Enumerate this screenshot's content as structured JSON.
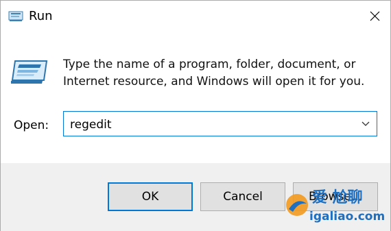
{
  "window": {
    "title": "Run",
    "icon": "run-icon"
  },
  "dialog": {
    "description_line1": "Type the name of a program, folder, document, or",
    "description_line2": "Internet resource, and Windows will open it for you.",
    "open_label": "Open:",
    "open_value": "regedit"
  },
  "buttons": {
    "ok": "OK",
    "cancel": "Cancel",
    "browse": "Browse..."
  },
  "watermark": {
    "text_cn": "爱 尬聊",
    "domain": "igaliao.com"
  },
  "colors": {
    "accent": "#0078d7",
    "footer_bg": "#f0f0f0",
    "button_bg": "#e1e1e1"
  }
}
